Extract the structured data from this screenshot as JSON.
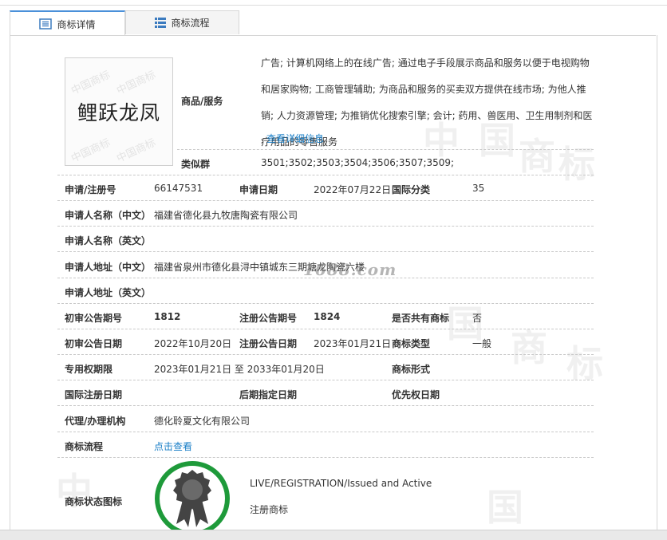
{
  "tabs": [
    {
      "label": "商标详情",
      "icon": "document-list-icon",
      "active": true
    },
    {
      "label": "商标流程",
      "icon": "grid-list-icon",
      "active": false
    }
  ],
  "logo": {
    "text": "鲤跃龙凤",
    "watermark": "中国商标"
  },
  "goods": {
    "label": "商品/服务",
    "text": "广告; 计算机网络上的在线广告; 通过电子手段展示商品和服务以便于电视购物和居家购物; 工商管理辅助; 为商品和服务的买卖双方提供在线市场; 为他人推销; 人力资源管理; 为推销优化搜索引擎; 会计; 药用、兽医用、卫生用制剂和医疗用品的零售服务",
    "more_link": "查看详细信息"
  },
  "similar_group": {
    "label": "类似群",
    "value": "3501;3502;3503;3504;3506;3507;3509;"
  },
  "row_reg": {
    "reg_no_label": "申请/注册号",
    "reg_no": "66147531",
    "apply_date_label": "申请日期",
    "apply_date": "2022年07月22日",
    "intl_class_label": "国际分类",
    "intl_class": "35"
  },
  "applicant_cn": {
    "label": "申请人名称（中文）",
    "value": "福建省德化县九牧唐陶瓷有限公司"
  },
  "applicant_en": {
    "label": "申请人名称（英文）",
    "value": ""
  },
  "address_cn": {
    "label": "申请人地址（中文）",
    "value": "福建省泉州市德化县浔中镇城东三期塘龙陶瓷六楼"
  },
  "address_en": {
    "label": "申请人地址（英文）",
    "value": ""
  },
  "row_issue": {
    "prelim_no_label": "初审公告期号",
    "prelim_no": "1812",
    "reg_issue_label": "注册公告期号",
    "reg_issue": "1824",
    "shared_label": "是否共有商标",
    "shared": "否"
  },
  "row_dates": {
    "prelim_date_label": "初审公告日期",
    "prelim_date": "2022年10月20日",
    "reg_date_label": "注册公告日期",
    "reg_date": "2023年01月21日",
    "type_label": "商标类型",
    "type": "一般"
  },
  "row_term": {
    "term_label": "专用权期限",
    "term": "2023年01月21日 至 2033年01月20日",
    "form_label": "商标形式",
    "form": ""
  },
  "row_intl": {
    "intl_reg_label": "国际注册日期",
    "intl_reg": "",
    "later_label": "后期指定日期",
    "later": "",
    "priority_label": "优先权日期",
    "priority": ""
  },
  "agent": {
    "label": "代理/办理机构",
    "value": "德化聆夏文化有限公司"
  },
  "flow": {
    "label": "商标流程",
    "link": "点击查看"
  },
  "status": {
    "label": "商标状态图标",
    "status_en": "LIVE/REGISTRATION/Issued and Active",
    "status_cn": "注册商标",
    "icon": "award-medal-icon"
  },
  "watermark": {
    "text": "1688.com"
  },
  "colors": {
    "link": "#1a7fc7",
    "tab_accent": "#4a90d9",
    "medal_ring": "#1e9a3a",
    "medal_body": "#444444"
  }
}
